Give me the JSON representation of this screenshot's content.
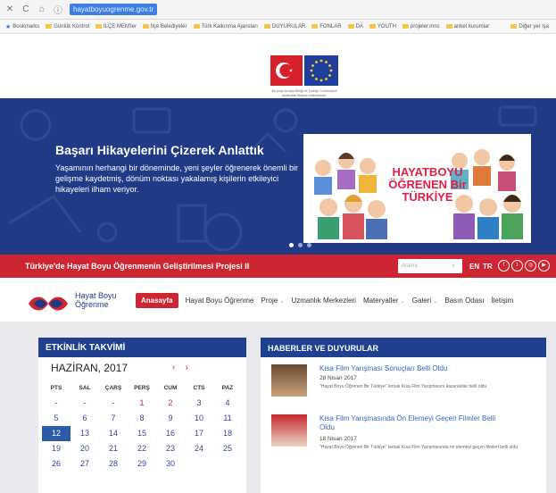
{
  "browser": {
    "nav_glyphs": [
      "✕",
      "C",
      "⌂"
    ],
    "url": "hayatboyuogrenme.gov.tr",
    "bookmarks": [
      "Bookmarks",
      "Günlük Kontrol",
      "İLÇE MEM'ler",
      "İlçe Belediyeler",
      "Türk Kalkınma Ajansları",
      "DUYURULAR",
      "FONLAR",
      "DA",
      "YOUTH",
      "projeler.mnc",
      "anket kurumlar"
    ],
    "other_bookmarks": "Diğer yer işa"
  },
  "header": {
    "caption": "Bu proje Avrupa Birliği ve Türkiye Cumhuriyeti tarafından finanse edilmektedir."
  },
  "hero": {
    "title": "Başarı Hikayelerini Çizerek Anlattık",
    "text": "Yaşamının herhangi bir döneminde, yeni şeyler öğrenerek önemli bir gelişme kaydetmiş, dönüm noktası yakalamış kişilerin etkileyici hikayeleri ilham veriyor.",
    "art_title": "HAYATBOYU ÖĞRENEN Bir TÜRKİYE",
    "slide_count": 3,
    "active_slide": 1
  },
  "project_strip": {
    "title": "Türkiye'de Hayat Boyu Öğrenmenin Geliştirilmesi Projesi II",
    "search_placeholder": "Arama",
    "lang_en": "EN",
    "lang_tr": "TR",
    "social": [
      "f",
      "t",
      "◎",
      "▶"
    ]
  },
  "nav": {
    "logo_line1": "Hayat Boyu",
    "logo_line2": "Öğrenme",
    "items": [
      "Anasayfa",
      "Hayat Boyu Öğrenme",
      "Proje",
      "Uzmanlık Merkezleri",
      "Materyaller",
      "Galeri",
      "Basın Odası",
      "İletişim"
    ],
    "caret": "⌄"
  },
  "calendar": {
    "title": "ETKİNLİK TAKVİMİ",
    "month": "HAZİRAN, 2017",
    "prev": "‹",
    "next": "›",
    "weekdays": [
      "PTS",
      "SAL",
      "ÇARŞ",
      "PERŞ",
      "CUM",
      "CTS",
      "PAZ"
    ],
    "weeks": [
      [
        "-",
        "-",
        "-",
        "1",
        "2",
        "3",
        "4"
      ],
      [
        "5",
        "6",
        "7",
        "8",
        "9",
        "10",
        "11"
      ],
      [
        "12",
        "13",
        "14",
        "15",
        "16",
        "17",
        "18"
      ],
      [
        "19",
        "20",
        "21",
        "22",
        "23",
        "24",
        "25"
      ],
      [
        "26",
        "27",
        "28",
        "29",
        "30",
        "",
        ""
      ]
    ],
    "highlight_red": [
      "1",
      "2"
    ],
    "today": "12"
  },
  "news": {
    "title": "HABERLER VE DUYURULAR",
    "items": [
      {
        "title": "Kısa Film Yarışması Sonuçları Belli Oldu",
        "date": "28 Nisan 2017",
        "desc": "\"Hayat Boyu Öğrenen Bir Türkiye\" temalı Kısa Film Yarışmasını kazananlar belli oldu"
      },
      {
        "title": "Kısa Film Yarışmasında Ön Elemeyi Geçen Filmler Belli Oldu",
        "date": "18 Nisan 2017",
        "desc": "\"Hayat Boyu Öğrenen Bir Türkiye\" temalı Kısa Film Yarışmasında ön elemeyi geçen filmleri belli oldu"
      }
    ]
  },
  "colors": {
    "brand_blue": "#203a86",
    "brand_red": "#cd2531",
    "link_blue": "#3069c4"
  }
}
